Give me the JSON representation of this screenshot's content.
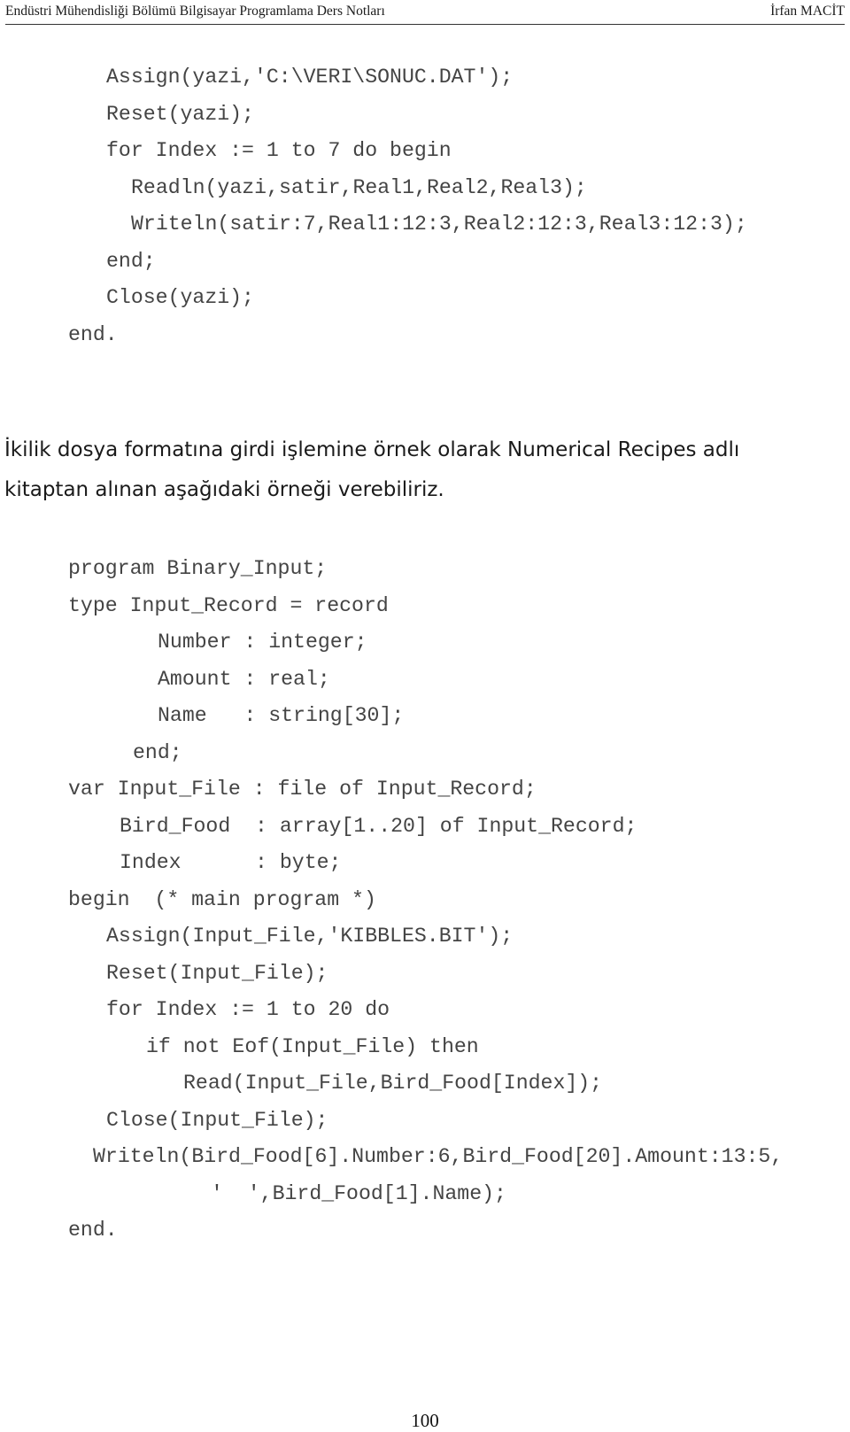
{
  "header": {
    "left": "Endüstri Mühendisliği Bölümü Bilgisayar Programlama Ders Notları",
    "right": "İrfan MACİT"
  },
  "code_block_1": [
    "Assign(yazi,'C:\\VERI\\SONUC.DAT');",
    "Reset(yazi);",
    "for Index := 1 to 7 do begin",
    "Readln(yazi,satir,Real1,Real2,Real3);",
    "Writeln(satir:7,Real1:12:3,Real2:12:3,Real3:12:3);",
    "end;",
    "Close(yazi);",
    "end."
  ],
  "paragraph": {
    "line1": "İkilik dosya formatına girdi işlemine örnek olarak Numerical Recipes adlı",
    "line2": "kitaptan alınan aşağıdaki örneği verebiliriz."
  },
  "code_block_2": [
    "program Binary_Input;",
    "type Input_Record = record",
    "Number : integer;",
    "Amount : real;",
    "Name   : string[30];",
    "end;",
    "var Input_File : file of Input_Record;",
    "Bird_Food  : array[1..20] of Input_Record;",
    "Index      : byte;",
    "begin  (* main program *)",
    "Assign(Input_File,'KIBBLES.BIT');",
    "Reset(Input_File);",
    "for Index := 1 to 20 do",
    "if not Eof(Input_File) then",
    "Read(Input_File,Bird_Food[Index]);",
    "Close(Input_File);",
    "Writeln(Bird_Food[6].Number:6,Bird_Food[20].Amount:13:5,",
    "'  ',Bird_Food[1].Name);",
    "end."
  ],
  "page_number": "100"
}
